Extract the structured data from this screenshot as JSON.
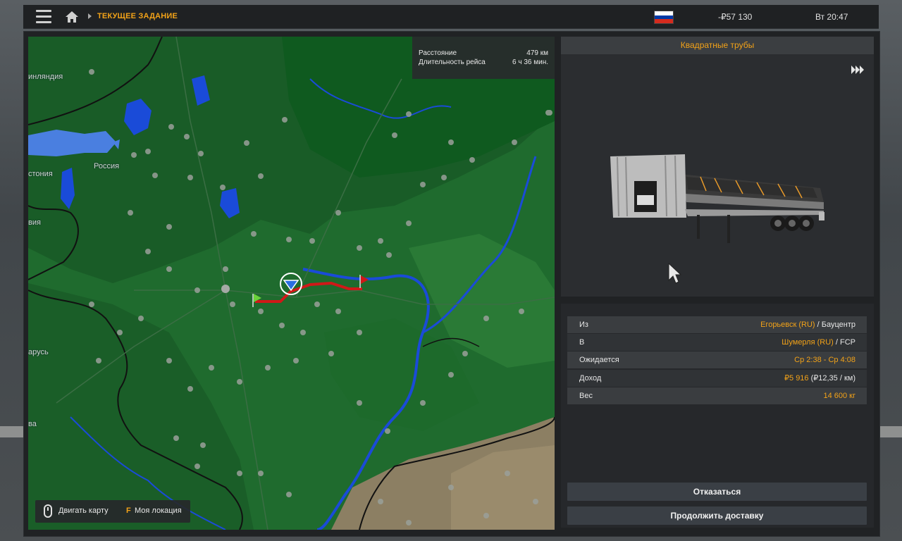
{
  "topbar": {
    "breadcrumb": "ТЕКУЩЕЕ ЗАДАНИЕ",
    "money": "-₽57 130",
    "clock": "Вт 20:47",
    "flag_colors": [
      "#ffffff",
      "#0039a6",
      "#d52b1e"
    ]
  },
  "map": {
    "labels": {
      "finland": "инляндия",
      "russia": "Россия",
      "estonia": "стония",
      "latvia": "вия",
      "belarus": "арусь",
      "lithuania": "ва"
    },
    "route_info": {
      "distance_label": "Расстояние",
      "distance_value": "479 км",
      "duration_label": "Длительность рейса",
      "duration_value": "6 ч 36 мин."
    },
    "legend": {
      "move_label": "Двигать карту",
      "location_key": "F",
      "location_label": "Моя локация"
    },
    "colors": {
      "land": "#1f6b2e",
      "forest": "#195c27",
      "water": "#1a4bd8",
      "route": "#d01818",
      "border": "#111111"
    }
  },
  "cargo": {
    "title": "Квадратные трубы"
  },
  "details": {
    "from": {
      "label": "Из",
      "city": "Егорьевск (RU)",
      "company": " / Бауцентр"
    },
    "to": {
      "label": "В",
      "city": "Шумерля (RU)",
      "company": " / FCP"
    },
    "expected": {
      "label": "Ожидается",
      "value": "Ср 2:38 - Ср 4:08"
    },
    "income": {
      "label": "Доход",
      "value": "₽5 916",
      "rate": " (₽12,35 / км)"
    },
    "weight": {
      "label": "Вес",
      "value": "14 600 кг"
    }
  },
  "buttons": {
    "cancel": "Отказаться",
    "continue": "Продолжить доставку"
  }
}
